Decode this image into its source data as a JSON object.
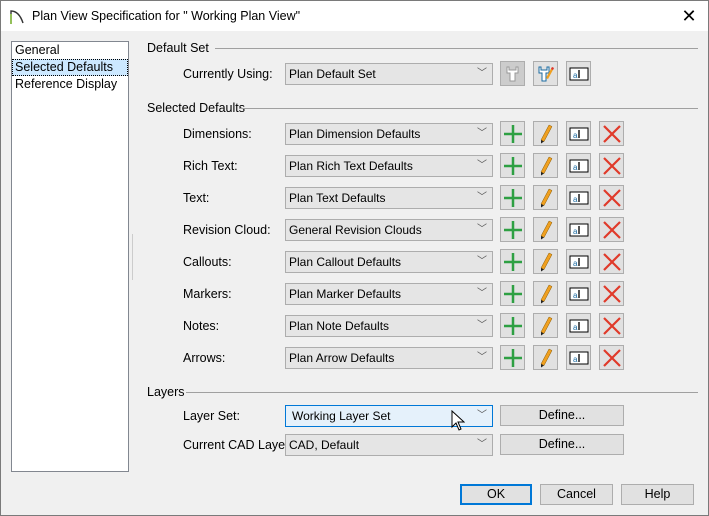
{
  "window": {
    "title": "Plan View Specification for \" Working Plan View\""
  },
  "sidebar": {
    "items": [
      {
        "label": "General"
      },
      {
        "label": "Selected Defaults",
        "selected": true
      },
      {
        "label": "Reference Display"
      }
    ]
  },
  "default_set": {
    "section": "Default Set",
    "label": "Currently Using:",
    "value": "Plan Default Set"
  },
  "selected_defaults": {
    "section": "Selected Defaults",
    "rows": [
      {
        "label": "Dimensions:",
        "value": "Plan Dimension Defaults"
      },
      {
        "label": "Rich Text:",
        "value": "Plan Rich Text Defaults"
      },
      {
        "label": "Text:",
        "value": "Plan Text Defaults"
      },
      {
        "label": "Revision Cloud:",
        "value": "General Revision Clouds"
      },
      {
        "label": "Callouts:",
        "value": "Plan Callout Defaults"
      },
      {
        "label": "Markers:",
        "value": "Plan Marker Defaults"
      },
      {
        "label": "Notes:",
        "value": "Plan Note Defaults"
      },
      {
        "label": "Arrows:",
        "value": "Plan Arrow Defaults"
      }
    ]
  },
  "layers": {
    "section": "Layers",
    "layer_set_label": "Layer Set:",
    "layer_set_value": "Working Layer Set",
    "cad_layer_label": "Current CAD Layer:",
    "cad_layer_value": "CAD,  Default",
    "define_label": "Define..."
  },
  "footer": {
    "ok": "OK",
    "cancel": "Cancel",
    "help": "Help"
  },
  "colors": {
    "accent": "#0078d7",
    "add": "#2ea043",
    "delete": "#e03a2a"
  }
}
